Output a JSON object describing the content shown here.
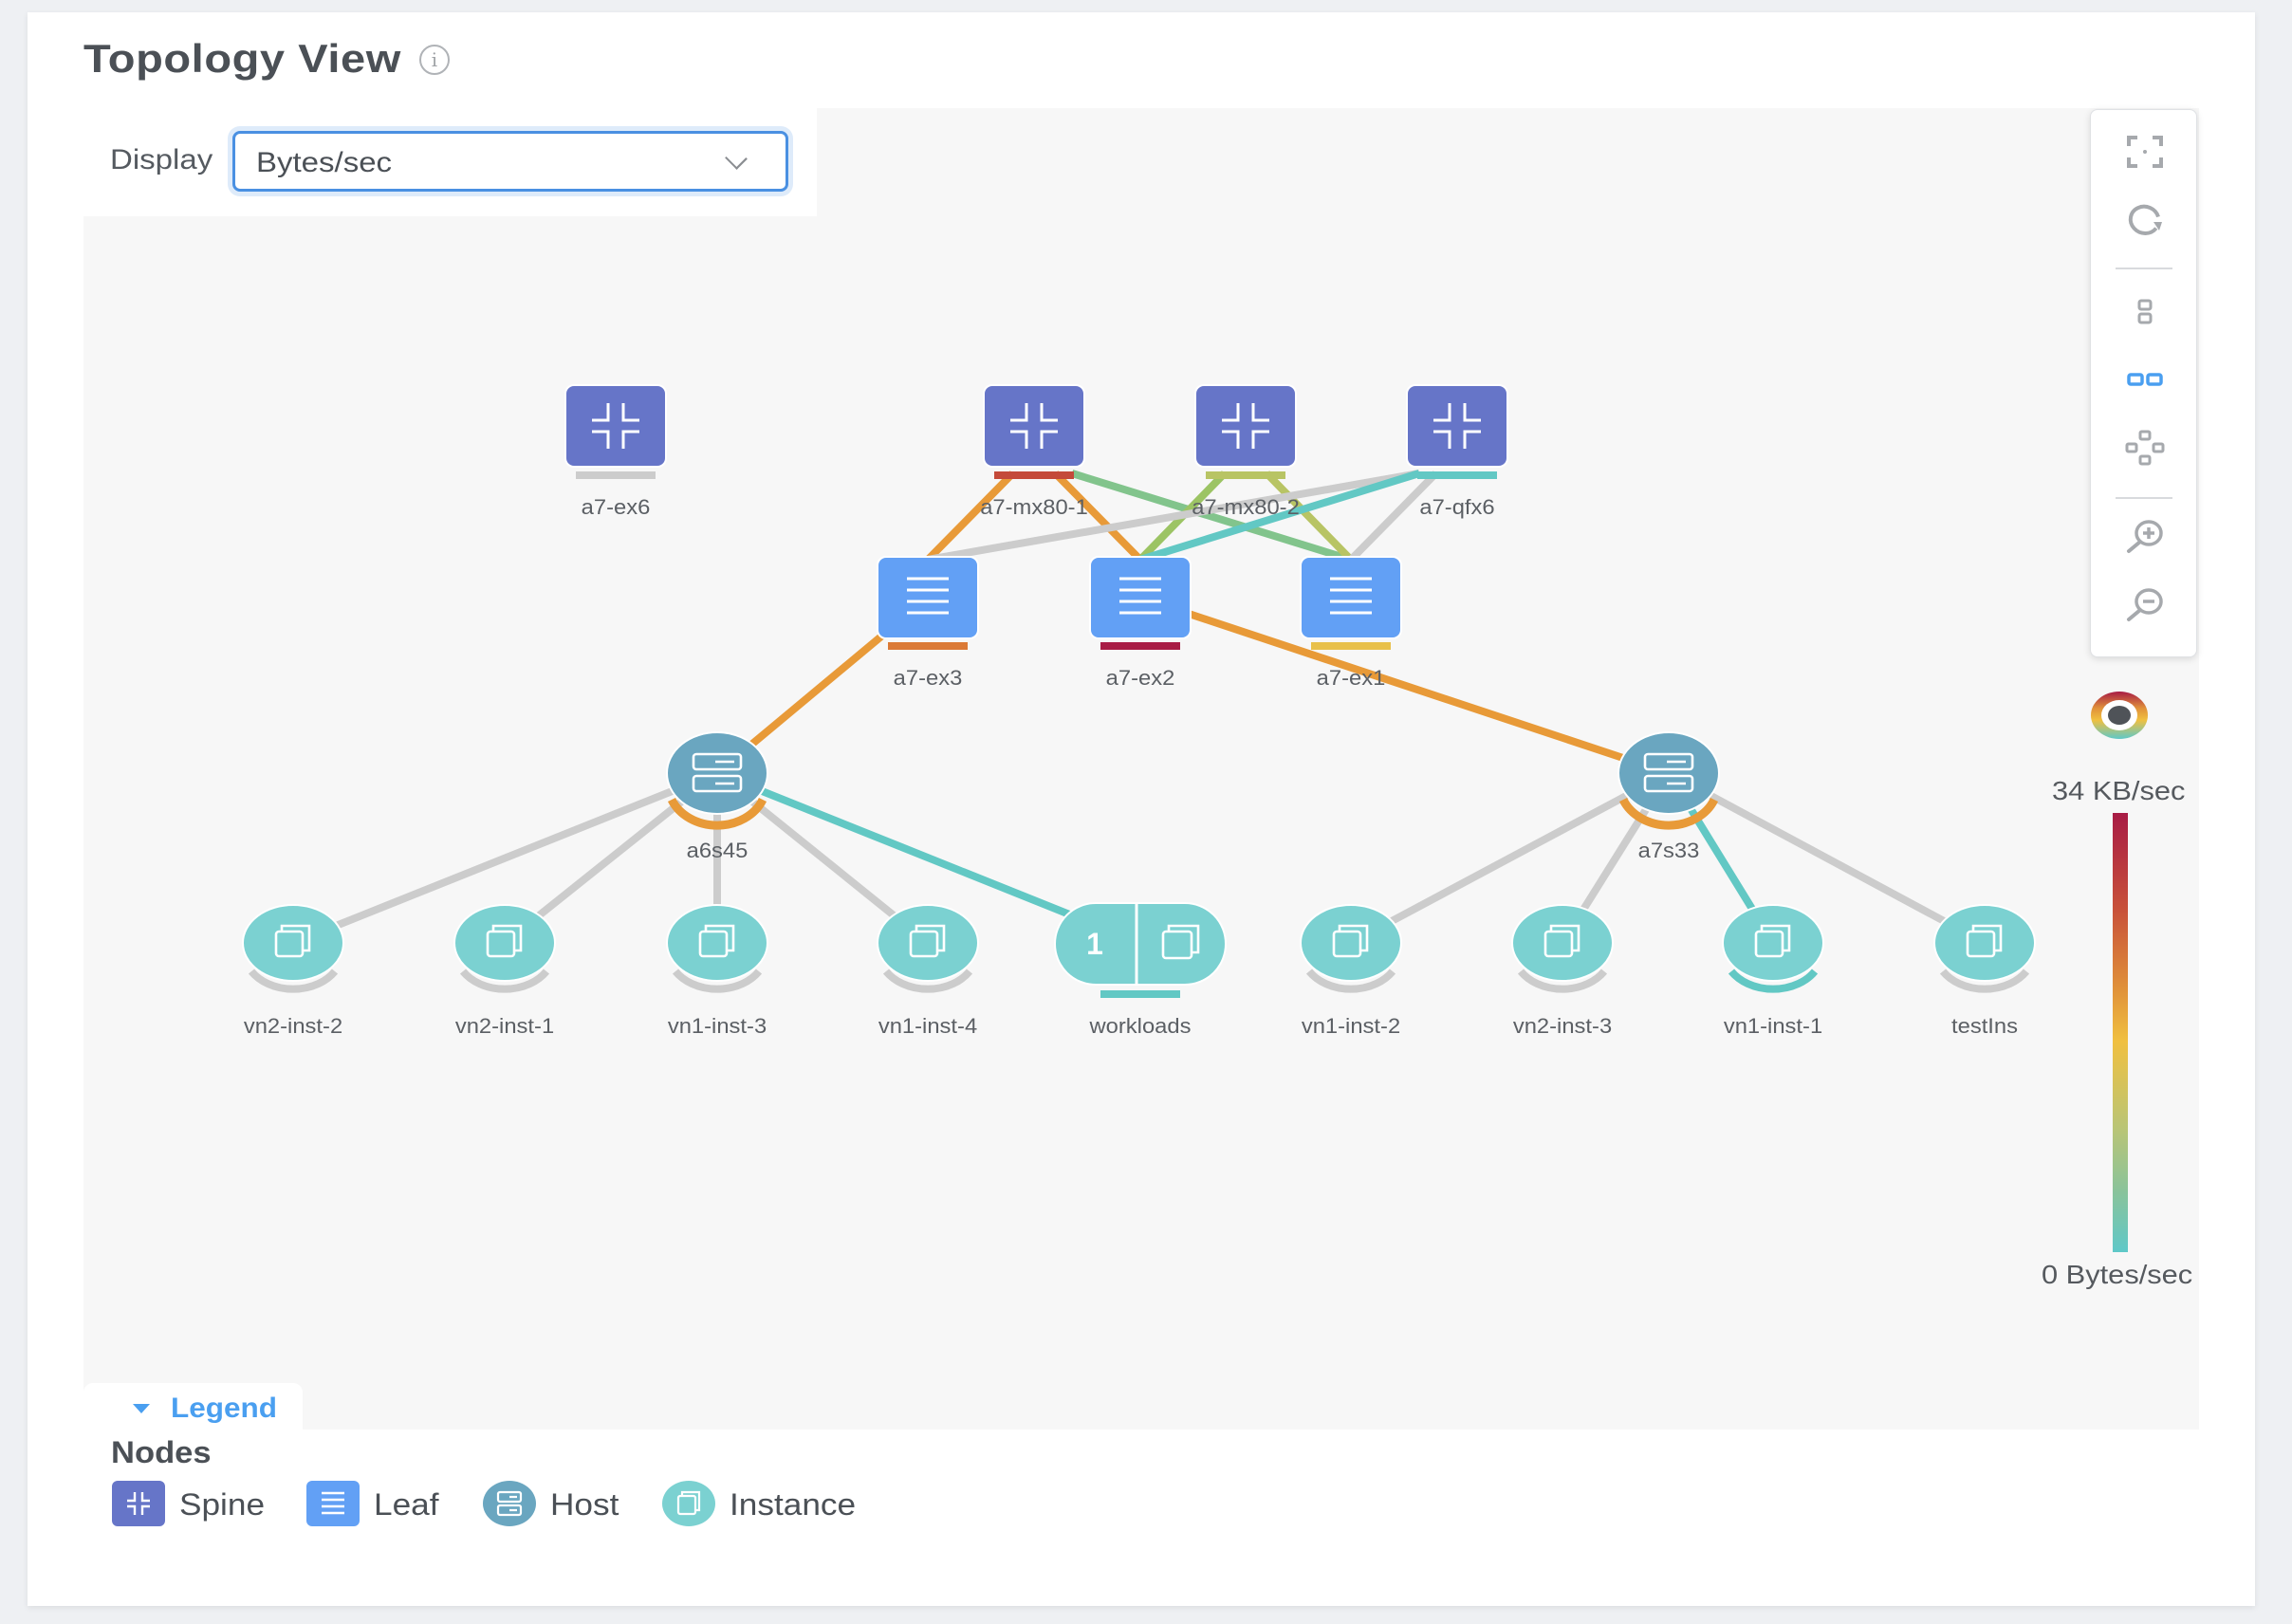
{
  "page": {
    "title": "Topology View",
    "info_icon": "info-circle-icon"
  },
  "display": {
    "label": "Display",
    "selected": "Bytes/sec"
  },
  "controls": [
    {
      "name": "fit-to-screen",
      "icon": "fit-screen-icon",
      "active": false
    },
    {
      "name": "refresh",
      "icon": "refresh-icon",
      "active": false
    },
    {
      "name": "layout-vertical",
      "icon": "layout-vertical-icon",
      "active": false
    },
    {
      "name": "layout-horizontal",
      "icon": "layout-horizontal-icon",
      "active": true
    },
    {
      "name": "layout-radial",
      "icon": "layout-radial-icon",
      "active": false
    },
    {
      "name": "zoom-in",
      "icon": "zoom-in-icon",
      "active": false
    },
    {
      "name": "zoom-out",
      "icon": "zoom-out-icon",
      "active": false
    }
  ],
  "color_scale": {
    "max_label": "34 KB/sec",
    "min_label": "0 Bytes/sec",
    "colors": [
      "#a81c45",
      "#c8513a",
      "#e0913a",
      "#f0c040",
      "#b9c576",
      "#8ac39a",
      "#5fc8c8"
    ]
  },
  "colors": {
    "spine": "#6675c8",
    "leaf": "#62a0f5",
    "host": "#6aa6c0",
    "instance": "#7bd1d1",
    "idle_link": "#cccccc",
    "accent": "#4a90e2"
  },
  "nodes": [
    {
      "id": "a7-ex6",
      "label": "a7-ex6",
      "type": "spine",
      "status": "#cccccc"
    },
    {
      "id": "a7-mx80-1",
      "label": "a7-mx80-1",
      "type": "spine",
      "status": "#c44a3a"
    },
    {
      "id": "a7-mx80-2",
      "label": "a7-mx80-2",
      "type": "spine",
      "status": "#b8c464"
    },
    {
      "id": "a7-qfx6",
      "label": "a7-qfx6",
      "type": "spine",
      "status": "#62c8c4"
    },
    {
      "id": "a7-ex3",
      "label": "a7-ex3",
      "type": "leaf",
      "status": "#db7a36"
    },
    {
      "id": "a7-ex2",
      "label": "a7-ex2",
      "type": "leaf",
      "status": "#a81c45"
    },
    {
      "id": "a7-ex1",
      "label": "a7-ex1",
      "type": "leaf",
      "status": "#e8c04a"
    },
    {
      "id": "a6s45",
      "label": "a6s45",
      "type": "host",
      "status": "#e89a38"
    },
    {
      "id": "a7s33",
      "label": "a7s33",
      "type": "host",
      "status": "#e89a38"
    },
    {
      "id": "vn2-inst-2",
      "label": "vn2-inst-2",
      "type": "instance",
      "status": "#cccccc"
    },
    {
      "id": "vn2-inst-1",
      "label": "vn2-inst-1",
      "type": "instance",
      "status": "#cccccc"
    },
    {
      "id": "vn1-inst-3",
      "label": "vn1-inst-3",
      "type": "instance",
      "status": "#cccccc"
    },
    {
      "id": "vn1-inst-4",
      "label": "vn1-inst-4",
      "type": "instance",
      "status": "#cccccc"
    },
    {
      "id": "workloads",
      "label": "workloads",
      "type": "group",
      "count": "1",
      "status": "#62c8c4"
    },
    {
      "id": "vn1-inst-2",
      "label": "vn1-inst-2",
      "type": "instance",
      "status": "#cccccc"
    },
    {
      "id": "vn2-inst-3",
      "label": "vn2-inst-3",
      "type": "instance",
      "status": "#cccccc"
    },
    {
      "id": "vn1-inst-1",
      "label": "vn1-inst-1",
      "type": "instance",
      "status": "#62c8c4"
    },
    {
      "id": "testIns",
      "label": "testIns",
      "type": "instance",
      "status": "#cccccc"
    }
  ],
  "links": [
    {
      "from": "a7-mx80-1",
      "to": "a7-ex3",
      "color": "#e89a38"
    },
    {
      "from": "a7-mx80-1",
      "to": "a7-ex2",
      "color": "#e89a38"
    },
    {
      "from": "a7-mx80-1",
      "to": "a7-ex1",
      "color": "#82c48c"
    },
    {
      "from": "a7-mx80-2",
      "to": "a7-ex2",
      "color": "#9cc464"
    },
    {
      "from": "a7-mx80-2",
      "to": "a7-ex1",
      "color": "#b8c464"
    },
    {
      "from": "a7-qfx6",
      "to": "a7-ex3",
      "color": "#cccccc"
    },
    {
      "from": "a7-qfx6",
      "to": "a7-ex2",
      "color": "#62c8c4"
    },
    {
      "from": "a7-qfx6",
      "to": "a7-ex1",
      "color": "#cccccc"
    },
    {
      "from": "a7-ex3",
      "to": "a6s45",
      "color": "#e89a38"
    },
    {
      "from": "a7-ex2",
      "to": "a7s33",
      "color": "#e89a38"
    },
    {
      "from": "a6s45",
      "to": "vn2-inst-2",
      "color": "#cccccc"
    },
    {
      "from": "a6s45",
      "to": "vn2-inst-1",
      "color": "#cccccc"
    },
    {
      "from": "a6s45",
      "to": "vn1-inst-3",
      "color": "#cccccc"
    },
    {
      "from": "a6s45",
      "to": "vn1-inst-4",
      "color": "#cccccc"
    },
    {
      "from": "a6s45",
      "to": "workloads",
      "color": "#62c8c4"
    },
    {
      "from": "a7s33",
      "to": "vn1-inst-2",
      "color": "#cccccc"
    },
    {
      "from": "a7s33",
      "to": "vn2-inst-3",
      "color": "#cccccc"
    },
    {
      "from": "a7s33",
      "to": "vn1-inst-1",
      "color": "#62c8c4"
    },
    {
      "from": "a7s33",
      "to": "testIns",
      "color": "#cccccc"
    }
  ],
  "legend": {
    "toggle_label": "Legend",
    "section_title": "Nodes",
    "items": [
      {
        "label": "Spine",
        "icon": "spine-icon"
      },
      {
        "label": "Leaf",
        "icon": "leaf-icon"
      },
      {
        "label": "Host",
        "icon": "host-icon"
      },
      {
        "label": "Instance",
        "icon": "instance-icon"
      }
    ]
  }
}
